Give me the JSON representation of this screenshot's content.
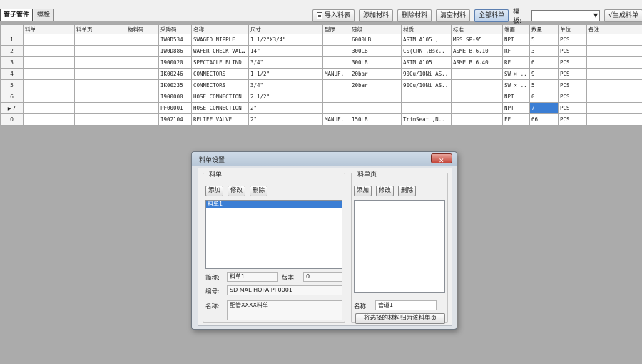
{
  "tabs": [
    {
      "label": "管子管件",
      "active": true
    },
    {
      "label": "螺栓",
      "active": false
    }
  ],
  "toolbar": {
    "import_label": "导入料表",
    "add_label": "添加材料",
    "delete_label": "删除材料",
    "clear_label": "清空材料",
    "all_label": "全部料单",
    "template_label": "模板:",
    "template_value": "",
    "generate_label": "√生成料单"
  },
  "grid": {
    "columns": [
      "",
      "料单",
      "料单页",
      "物料码",
      "采购码",
      "名称",
      "尺寸",
      "型厚",
      "磅级",
      "材质",
      "标准",
      "端面",
      "数量",
      "单位",
      "备注"
    ],
    "rows": [
      {
        "num": "1",
        "cells": [
          "",
          "",
          "",
          "IW0D534",
          "SWAGED NIPPLE",
          "1 1/2\"X3/4\"",
          "",
          "6000LB",
          "ASTM A105 ,",
          "MSS SP-95",
          "NPT",
          "5",
          "PCS",
          ""
        ]
      },
      {
        "num": "2",
        "cells": [
          "",
          "",
          "",
          "IW0D886",
          "WAFER CHECK VALVE",
          "14\"",
          "",
          "300LB",
          "CS(CRN ,Bsc..",
          "ASME B.6.10",
          "RF",
          "3",
          "PCS",
          ""
        ]
      },
      {
        "num": "3",
        "cells": [
          "",
          "",
          "",
          "I900020",
          "SPECTACLE BLIND",
          "3/4\"",
          "",
          "300LB",
          "ASTM A105",
          "ASME B.6.40",
          "RF",
          "6",
          "PCS",
          ""
        ]
      },
      {
        "num": "4",
        "cells": [
          "",
          "",
          "",
          "IK00246",
          "CONNECTORS",
          "1 1/2\"",
          "MANUF.",
          "20bar",
          "90Cu/10Ni AS..",
          "",
          "SW ×  ..",
          "9",
          "PCS",
          ""
        ]
      },
      {
        "num": "5",
        "cells": [
          "",
          "",
          "",
          "IK00235",
          "CONNECTORS",
          "3/4\"",
          "",
          "20bar",
          "90Cu/10Ni AS..",
          "",
          "SW ×  ..",
          "5",
          "PCS",
          ""
        ]
      },
      {
        "num": "6",
        "cells": [
          "",
          "",
          "",
          "I900000",
          "HOSE CONNECTION",
          "2 1/2\"",
          "",
          "",
          "",
          "",
          "NPT",
          "0",
          "PCS",
          ""
        ]
      },
      {
        "num": "7",
        "current": true,
        "cells": [
          "",
          "",
          "",
          "PF00001",
          "HOSE CONNECTION",
          "2\"",
          "",
          "",
          "",
          "",
          "NPT",
          "7",
          "PCS",
          ""
        ],
        "selected_col": 11
      },
      {
        "num": "0",
        "cells": [
          "",
          "",
          "",
          "I902104",
          "RELIEF VALVE",
          "2\"",
          "MANUF.",
          "150LB",
          "TrimSeat ,N..",
          "",
          "FF",
          "66",
          "PCS",
          ""
        ]
      }
    ]
  },
  "dialog": {
    "title": "料单设置",
    "close_label": "✕",
    "left_group": {
      "label": "料单",
      "add_label": "添加",
      "edit_label": "修改",
      "delete_label": "删除",
      "items": [
        {
          "label": "料单1",
          "selected": true
        }
      ],
      "name_label": "简称:",
      "name_value": "料单1",
      "version_label": "版本:",
      "version_value": "0",
      "code_label": "编号:",
      "code_value": "SD MAL HOPA PI 0001",
      "fullname_label": "名称:",
      "fullname_value": "配管XXXX料单"
    },
    "right_group": {
      "label": "料单页",
      "add_label": "添加",
      "edit_label": "修改",
      "delete_label": "删除",
      "items": [],
      "name_label": "名称:",
      "name_value": "管道1",
      "assign_label": "将选择的材料归为该料单页"
    }
  },
  "colors": {
    "selection": "#3b7ed4",
    "background": "#ababab",
    "close_red": "#c4463a"
  }
}
